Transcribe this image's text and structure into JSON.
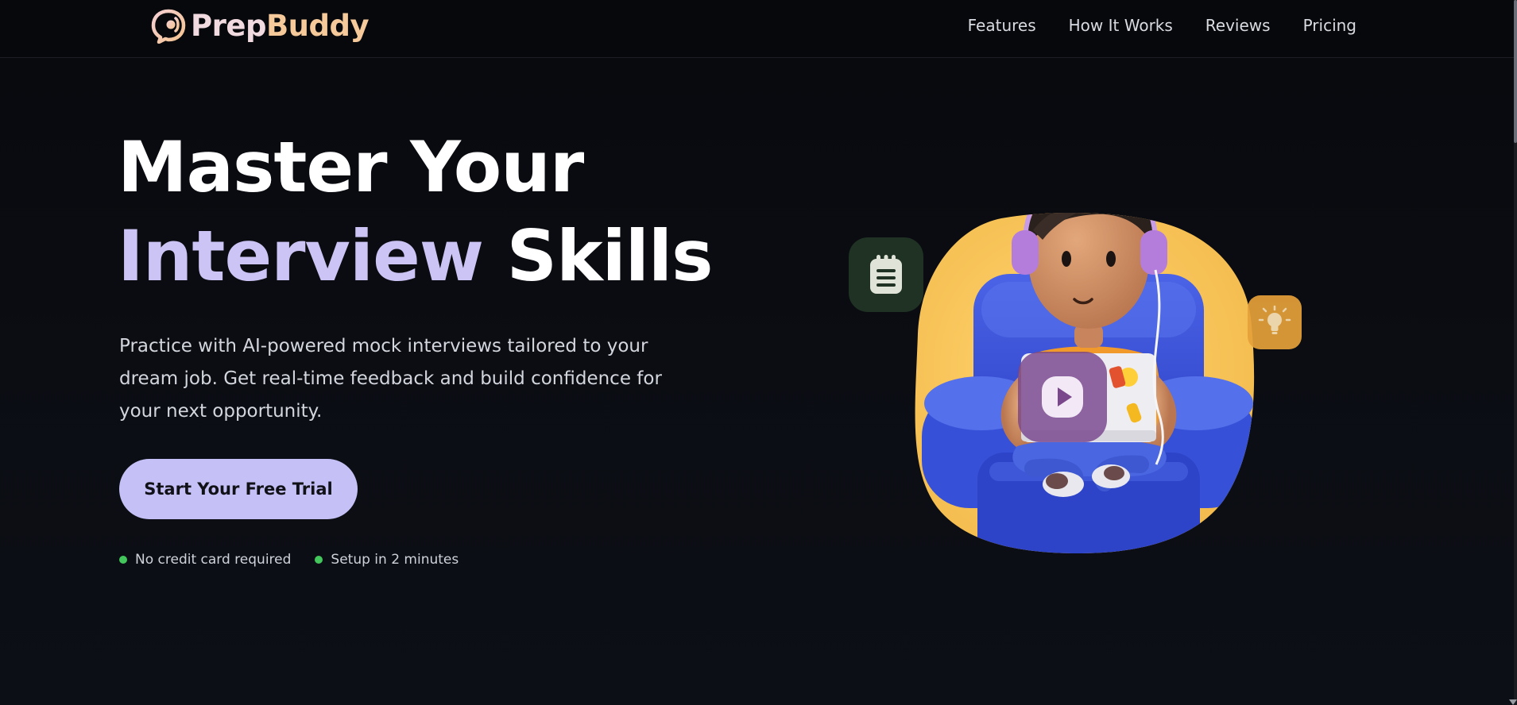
{
  "brand": {
    "prefix": "Prep",
    "suffix": "Buddy",
    "colors": {
      "prefix": "#f2dbe0",
      "suffix": "#f5c99a"
    }
  },
  "nav": {
    "links": [
      {
        "label": "Features"
      },
      {
        "label": "How It Works"
      },
      {
        "label": "Reviews"
      },
      {
        "label": "Pricing"
      }
    ]
  },
  "hero": {
    "title_line1": "Master Your",
    "title_accent": "Interview",
    "title_line2_rest": " Skills",
    "subtitle": "Practice with AI-powered mock interviews tailored to your dream job. Get real-time feedback and build confidence for your next opportunity.",
    "cta_label": "Start Your Free Trial",
    "notes": [
      {
        "label": "No credit card required"
      },
      {
        "label": "Setup in 2 minutes"
      }
    ],
    "accent_color": "#cbc4f5",
    "cta_color": "#c5c0f6",
    "note_dot_color": "#43c75c"
  },
  "illustration": {
    "subject": "3d-character-with-headphones-on-blue-armchair-with-laptop",
    "icons": [
      "notepad-icon",
      "lightbulb-icon",
      "play-icon"
    ],
    "colors": {
      "backdrop": "#f7c45a",
      "chair": "#3650d6",
      "notes_badge": "#1f3223",
      "bulb_badge": "#e6a13a",
      "play_badge": "#7a468c"
    }
  }
}
